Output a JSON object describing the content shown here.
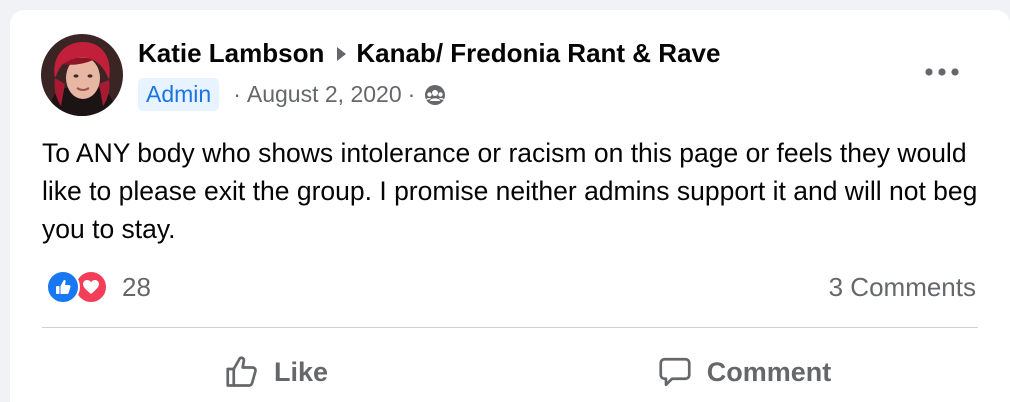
{
  "post": {
    "author": "Katie Lambson",
    "group": "Kanab/ Fredonia Rant & Rave",
    "badge": "Admin",
    "date": "August 2, 2020",
    "audience_icon": "group-members-icon",
    "more_icon": "more-options-icon",
    "text": "To ANY body who shows intolerance or racism on this page or feels they would like to please exit the group. I promise neither admins support it and will not beg you to stay."
  },
  "reactions": {
    "icons": [
      "like-reaction-icon",
      "love-reaction-icon"
    ],
    "count": "28",
    "comments": "3 Comments"
  },
  "actions": {
    "like_label": "Like",
    "comment_label": "Comment"
  },
  "colors": {
    "accent": "#1877f2",
    "love": "#f33e58",
    "badge_bg": "#e7f3ff",
    "badge_text": "#1b74e4",
    "muted": "#65676b",
    "text": "#050505"
  }
}
